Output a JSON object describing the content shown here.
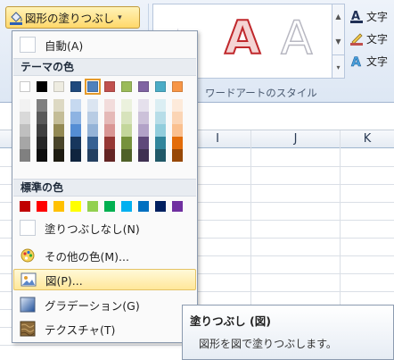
{
  "ribbon": {
    "fill_button_label": "図形の塗りつぶし",
    "fill_button_arrow": "▾",
    "wordart_group_label": "ワードアートのスタイル",
    "wordart_letters": [
      "A",
      "A",
      "A"
    ],
    "text_commands": [
      {
        "label": "文字",
        "icon": "text-fill-icon"
      },
      {
        "label": "文字",
        "icon": "text-outline-icon"
      },
      {
        "label": "文字",
        "icon": "text-effects-icon"
      }
    ]
  },
  "sheet": {
    "columns": [
      "I",
      "J",
      "K"
    ]
  },
  "dropdown": {
    "automatic_label": "自動(A)",
    "theme_colors_header": "テーマの色",
    "standard_colors_header": "標準の色",
    "theme_top_row": [
      "#ffffff",
      "#000000",
      "#eeece1",
      "#1f497d",
      "#4f81bd",
      "#c0504d",
      "#9bbb59",
      "#8064a2",
      "#4bacc6",
      "#f79646"
    ],
    "theme_shades": [
      [
        "#f2f2f2",
        "#d9d9d9",
        "#bfbfbf",
        "#a6a6a6",
        "#808080"
      ],
      [
        "#7f7f7f",
        "#595959",
        "#3f3f3f",
        "#262626",
        "#0d0d0d"
      ],
      [
        "#ddd9c3",
        "#c4bd97",
        "#938953",
        "#494429",
        "#1d1b10"
      ],
      [
        "#c6d9f0",
        "#8db3e2",
        "#548dd4",
        "#17365d",
        "#0f243e"
      ],
      [
        "#dbe5f1",
        "#b8cce4",
        "#95b3d7",
        "#366092",
        "#244061"
      ],
      [
        "#f2dcdb",
        "#e5b9b7",
        "#d99694",
        "#953734",
        "#632423"
      ],
      [
        "#ebf1dd",
        "#d7e3bc",
        "#c3d69b",
        "#76923c",
        "#4f6128"
      ],
      [
        "#e5e0ec",
        "#ccc1d9",
        "#b2a2c7",
        "#5f497a",
        "#3f3151"
      ],
      [
        "#dbeef3",
        "#b7dde8",
        "#92cddc",
        "#31859b",
        "#205867"
      ],
      [
        "#fdeada",
        "#fbd5b5",
        "#fac08f",
        "#e36c09",
        "#974806"
      ]
    ],
    "standard_colors": [
      "#c00000",
      "#ff0000",
      "#ffc000",
      "#ffff00",
      "#92d050",
      "#00b050",
      "#00b0f0",
      "#0070c0",
      "#002060",
      "#7030a0"
    ],
    "selected_theme_index": 4,
    "no_fill_label": "塗りつぶしなし(N)",
    "more_colors_label": "その他の色(M)...",
    "picture_label": "図(P)...",
    "gradient_label": "グラデーション(G)",
    "texture_label": "テクスチャ(T)"
  },
  "tooltip": {
    "title": "塗りつぶし (図)",
    "body": "図形を図で塗りつぶします。"
  }
}
